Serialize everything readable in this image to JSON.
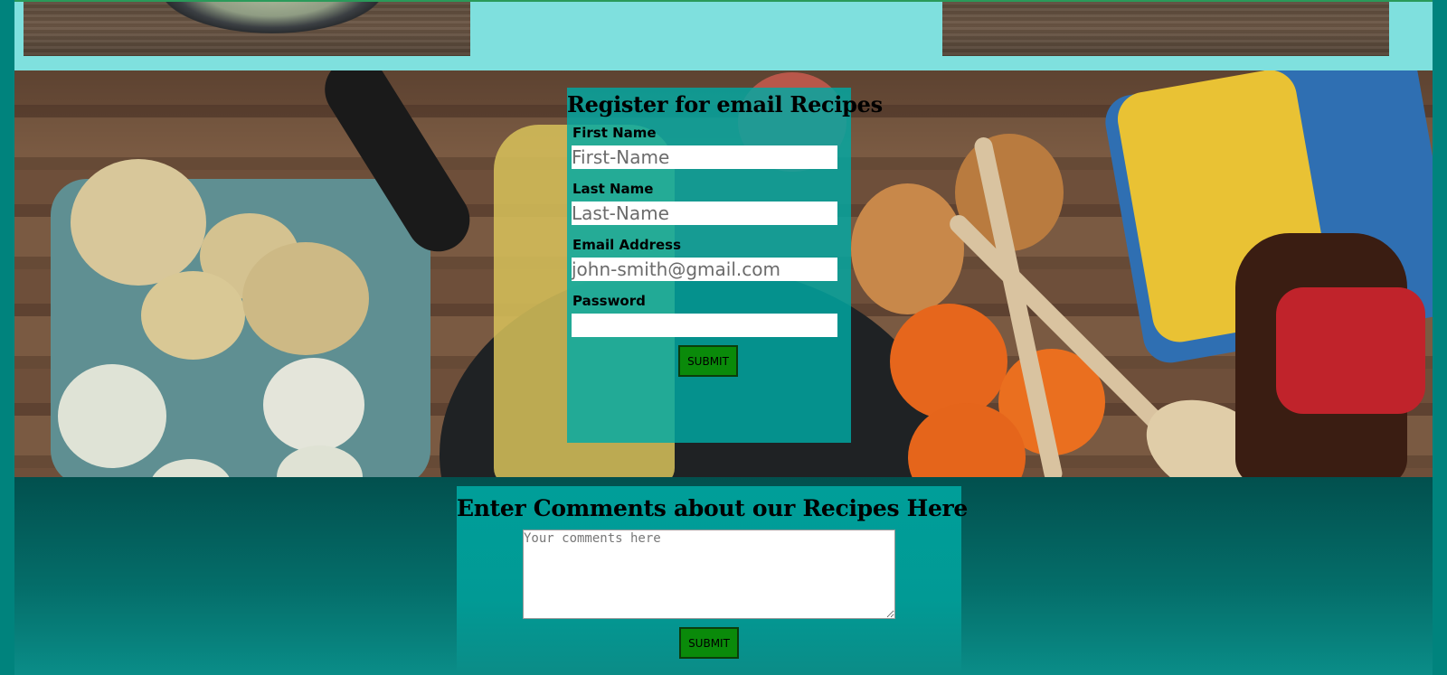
{
  "register": {
    "title": "Register for email Recipes",
    "first_name_label": "First Name",
    "first_name_placeholder": "First-Name",
    "last_name_label": "Last Name",
    "last_name_placeholder": "Last-Name",
    "email_label": "Email Address",
    "email_placeholder": "john-smith@gmail.com",
    "password_label": "Password",
    "password_placeholder": "",
    "submit_label": "SUBMIT"
  },
  "comments": {
    "title": "Enter Comments about our Recipes Here",
    "placeholder": "Your comments here",
    "submit_label": "SUBMIT"
  },
  "colors": {
    "page_background": "#00837d",
    "top_strip": "#7fe0de",
    "form_panel": "#00aaa5",
    "submit_button": "#0a8a0a"
  }
}
